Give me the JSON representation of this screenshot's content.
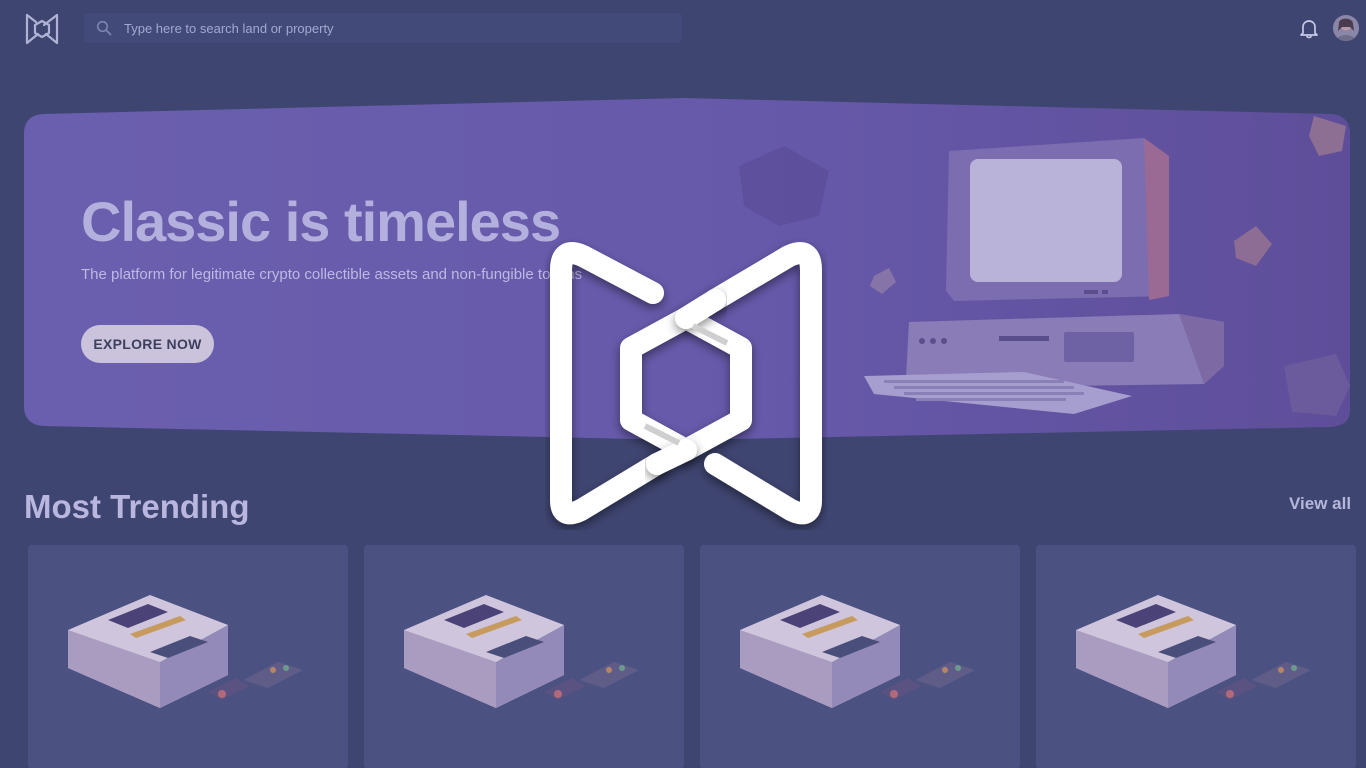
{
  "search": {
    "placeholder": "Type here to search land or property"
  },
  "hero": {
    "title": "Classic is timeless",
    "subtitle": "The platform for legitimate crypto collectible assets and non-fungible tokens",
    "button_label": "EXPLORE NOW"
  },
  "trending": {
    "title": "Most Trending",
    "view_all_label": "View all",
    "cards": [
      {
        "image": "retro-console"
      },
      {
        "image": "retro-console"
      },
      {
        "image": "retro-console"
      },
      {
        "image": "retro-console"
      }
    ]
  },
  "icons": {
    "logo": "brand-logo-icon",
    "search": "search-icon",
    "notifications": "bell-icon",
    "next": "chevron-right-icon"
  },
  "colors": {
    "background": "#3f4571",
    "hero": "#6f62b0",
    "card": "#4b5180",
    "logo_overlay": "#ffffff"
  }
}
